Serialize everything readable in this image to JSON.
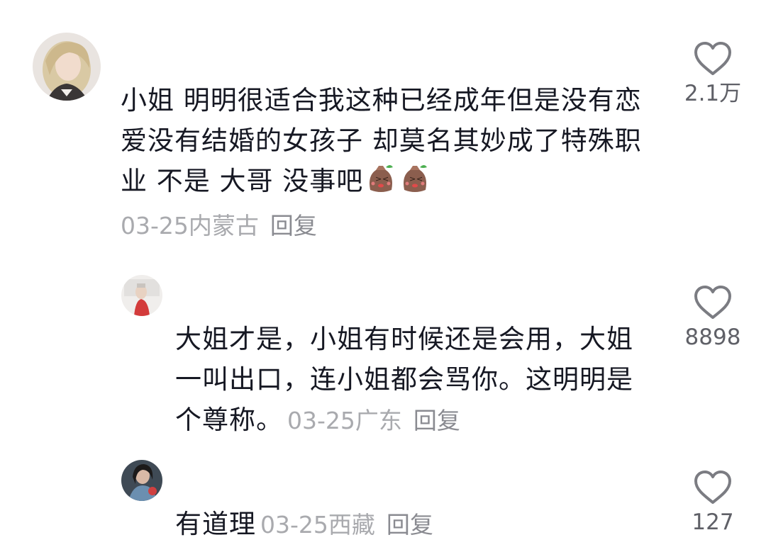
{
  "comments": [
    {
      "text": "小姐 明明很适合我这种已经成年但是没有恋爱没有结婚的女孩子 却莫名其妙成了特殊职业 不是 大哥 没事吧",
      "emojis": [
        "embarrassed-bag-emoji",
        "embarrassed-bag-emoji"
      ],
      "date": "03-25",
      "location": "内蒙古",
      "reply_label": "回复",
      "likes": "2.1万"
    },
    {
      "text": "大姐才是，小姐有时候还是会用，大姐一叫出口，连小姐都会骂你。这明明是个尊称。",
      "date": "03-25",
      "location": "广东",
      "reply_label": "回复",
      "likes": "8898"
    },
    {
      "text": "有道理",
      "date": "03-25",
      "location": "西藏",
      "reply_label": "回复",
      "likes": "127"
    }
  ],
  "icons": {
    "like": "heart-outline-icon",
    "avatar": "user-avatar"
  },
  "colors": {
    "text": "#161823",
    "meta": "#a9aaae",
    "like_stroke": "#7b7c82"
  }
}
